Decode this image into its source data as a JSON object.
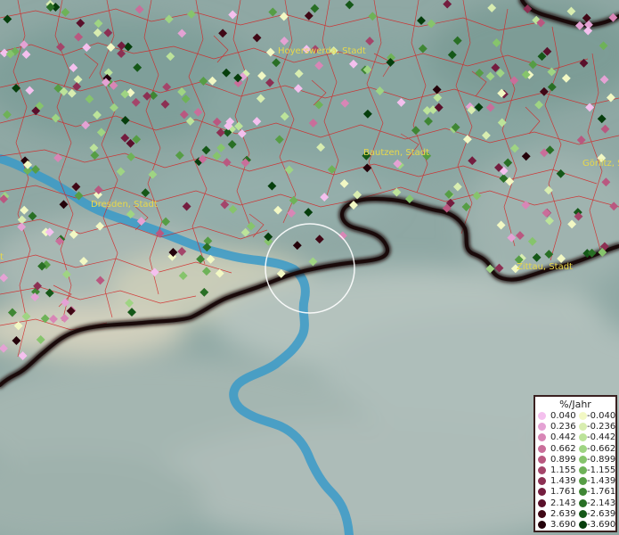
{
  "place_labels": [
    {
      "id": "hoyerswerda",
      "text": "Hoyerswerda, Stadt"
    },
    {
      "id": "bautzen",
      "text": "Bautzen, Stadt"
    },
    {
      "id": "dresden",
      "text": "Dresden, Stadt"
    },
    {
      "id": "zittau",
      "text": "Zittau, Stadt"
    },
    {
      "id": "goerlitz",
      "text": "Görlitz, S"
    },
    {
      "id": "left-edge",
      "text": "t"
    }
  ],
  "legend": {
    "title": "%/Jahr",
    "positive_labels": [
      "0.040",
      "0.236",
      "0.442",
      "0.662",
      "0.899",
      "1.155",
      "1.439",
      "1.761",
      "2.143",
      "2.639",
      "3.690"
    ],
    "negative_labels": [
      "-0.040",
      "-0.236",
      "-0.442",
      "-0.662",
      "-0.899",
      "-1.155",
      "-1.439",
      "-1.761",
      "-2.143",
      "-2.639",
      "-3.690"
    ],
    "positive_colors": [
      "#f4c0ee",
      "#e4a2d4",
      "#d886b6",
      "#c96e9a",
      "#b95880",
      "#a4456a",
      "#8c3053",
      "#741d3f",
      "#5a102b",
      "#400816",
      "#24020a"
    ],
    "negative_colors": [
      "#f2f8c4",
      "#d8edb0",
      "#bce39a",
      "#9fd483",
      "#86c46c",
      "#6eb258",
      "#569d45",
      "#3f8634",
      "#296f25",
      "#155818",
      "#063e0c"
    ]
  },
  "colors": {
    "background": "#9aaeaa",
    "district_lines": "#d42424",
    "border_line": "#1c0c0c",
    "river": "#3a9ac8",
    "selection_circle": "#ffffff"
  }
}
